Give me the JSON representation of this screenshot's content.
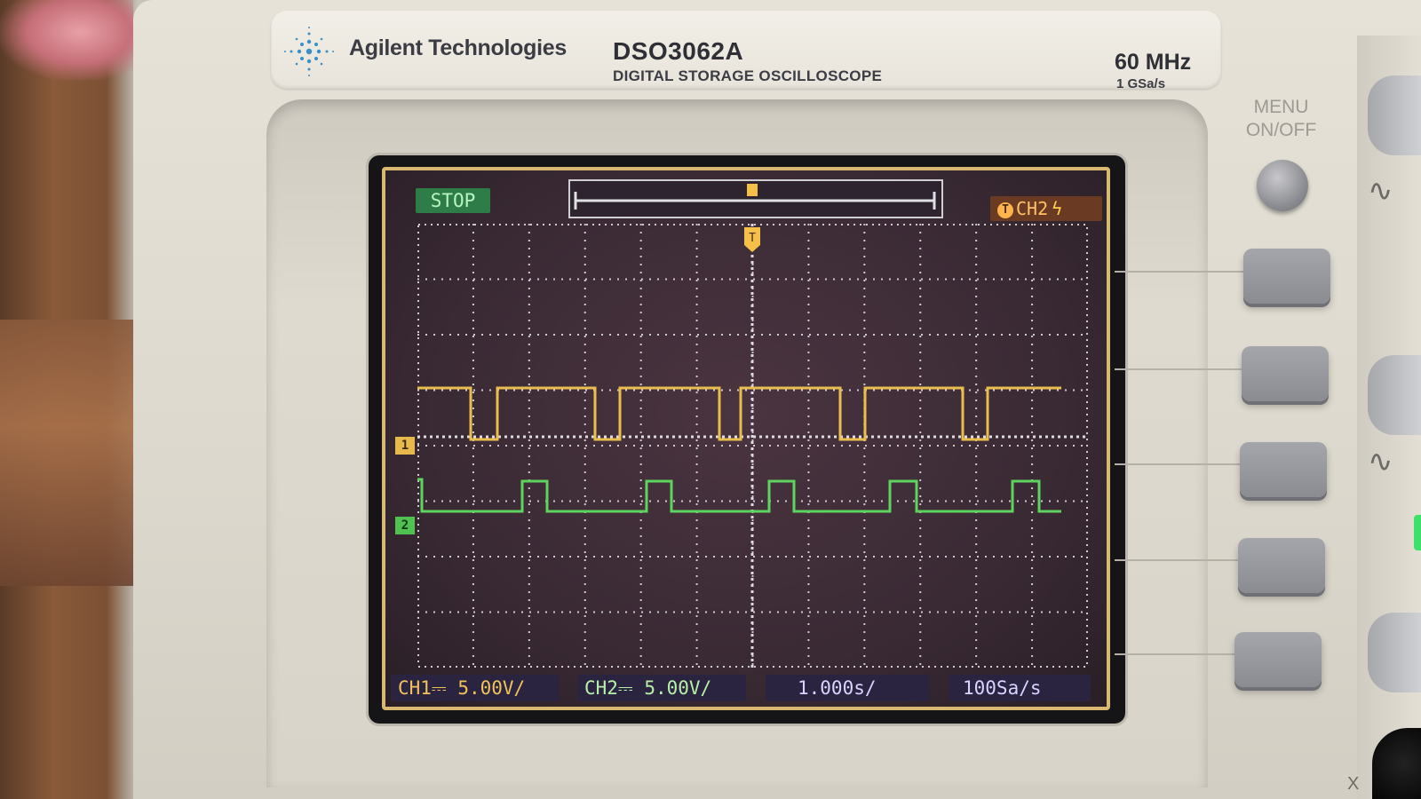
{
  "brand": {
    "name": "Agilent Technologies",
    "model": "DSO3062A",
    "model_description": "DIGITAL STORAGE OSCILLOSCOPE",
    "bandwidth": "60 MHz",
    "sample_rate": "1 GSa/s"
  },
  "screen": {
    "run_state": "STOP",
    "trigger_marker": "T",
    "trigger_source": "CH2",
    "channel_markers": {
      "ch1": "1",
      "ch2": "2"
    },
    "status": {
      "ch1_scale": "CH1⎓ 5.00V/",
      "ch2_scale": "CH2⎓ 5.00V/",
      "time_scale": "1.000s/",
      "sample_rate": "100Sa/s"
    }
  },
  "panel": {
    "menu_label_line1": "MENU",
    "menu_label_line2": "ON/OFF",
    "x_label": "X"
  },
  "colors": {
    "ch1_trace": "#e9bd4e",
    "ch2_trace": "#5fd35f",
    "grid": "#c9c4cc",
    "screen_bg": "#3a2a34"
  },
  "icons": [
    "agilent-spark-logo-icon",
    "trigger-t-icon",
    "edge-trigger-bolt-icon",
    "sine-wave-icon"
  ]
}
